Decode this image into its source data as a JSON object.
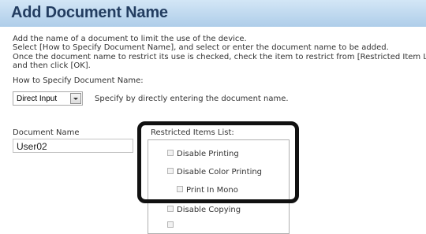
{
  "header": {
    "title": "Add Document Name"
  },
  "instructions": [
    "Add the name of a document to limit the use of the device.",
    "Select [How to Specify Document Name], and select or enter the document name to be added.",
    "Once the document name to restrict its use is checked, check the item to restrict from [Restricted Item List],",
    "and then click [OK]."
  ],
  "how_to_specify": {
    "label": "How to Specify Document Name:",
    "selected": "Direct Input",
    "description": "Specify by directly entering the document name."
  },
  "document_name": {
    "label": "Document Name",
    "value": "User02"
  },
  "restricted_items": {
    "label": "Restricted Items List:",
    "items": [
      {
        "label": "Disable Printing",
        "checked": false
      },
      {
        "label": "Disable Color Printing",
        "checked": false
      },
      {
        "label": "Print In Mono",
        "checked": false
      },
      {
        "label": "Disable Copying",
        "checked": false
      }
    ]
  },
  "colors": {
    "header_gradient_top": "#d3e6f6",
    "header_gradient_bottom": "#aecde9",
    "header_title": "#233d60",
    "highlight_border": "#111111"
  }
}
